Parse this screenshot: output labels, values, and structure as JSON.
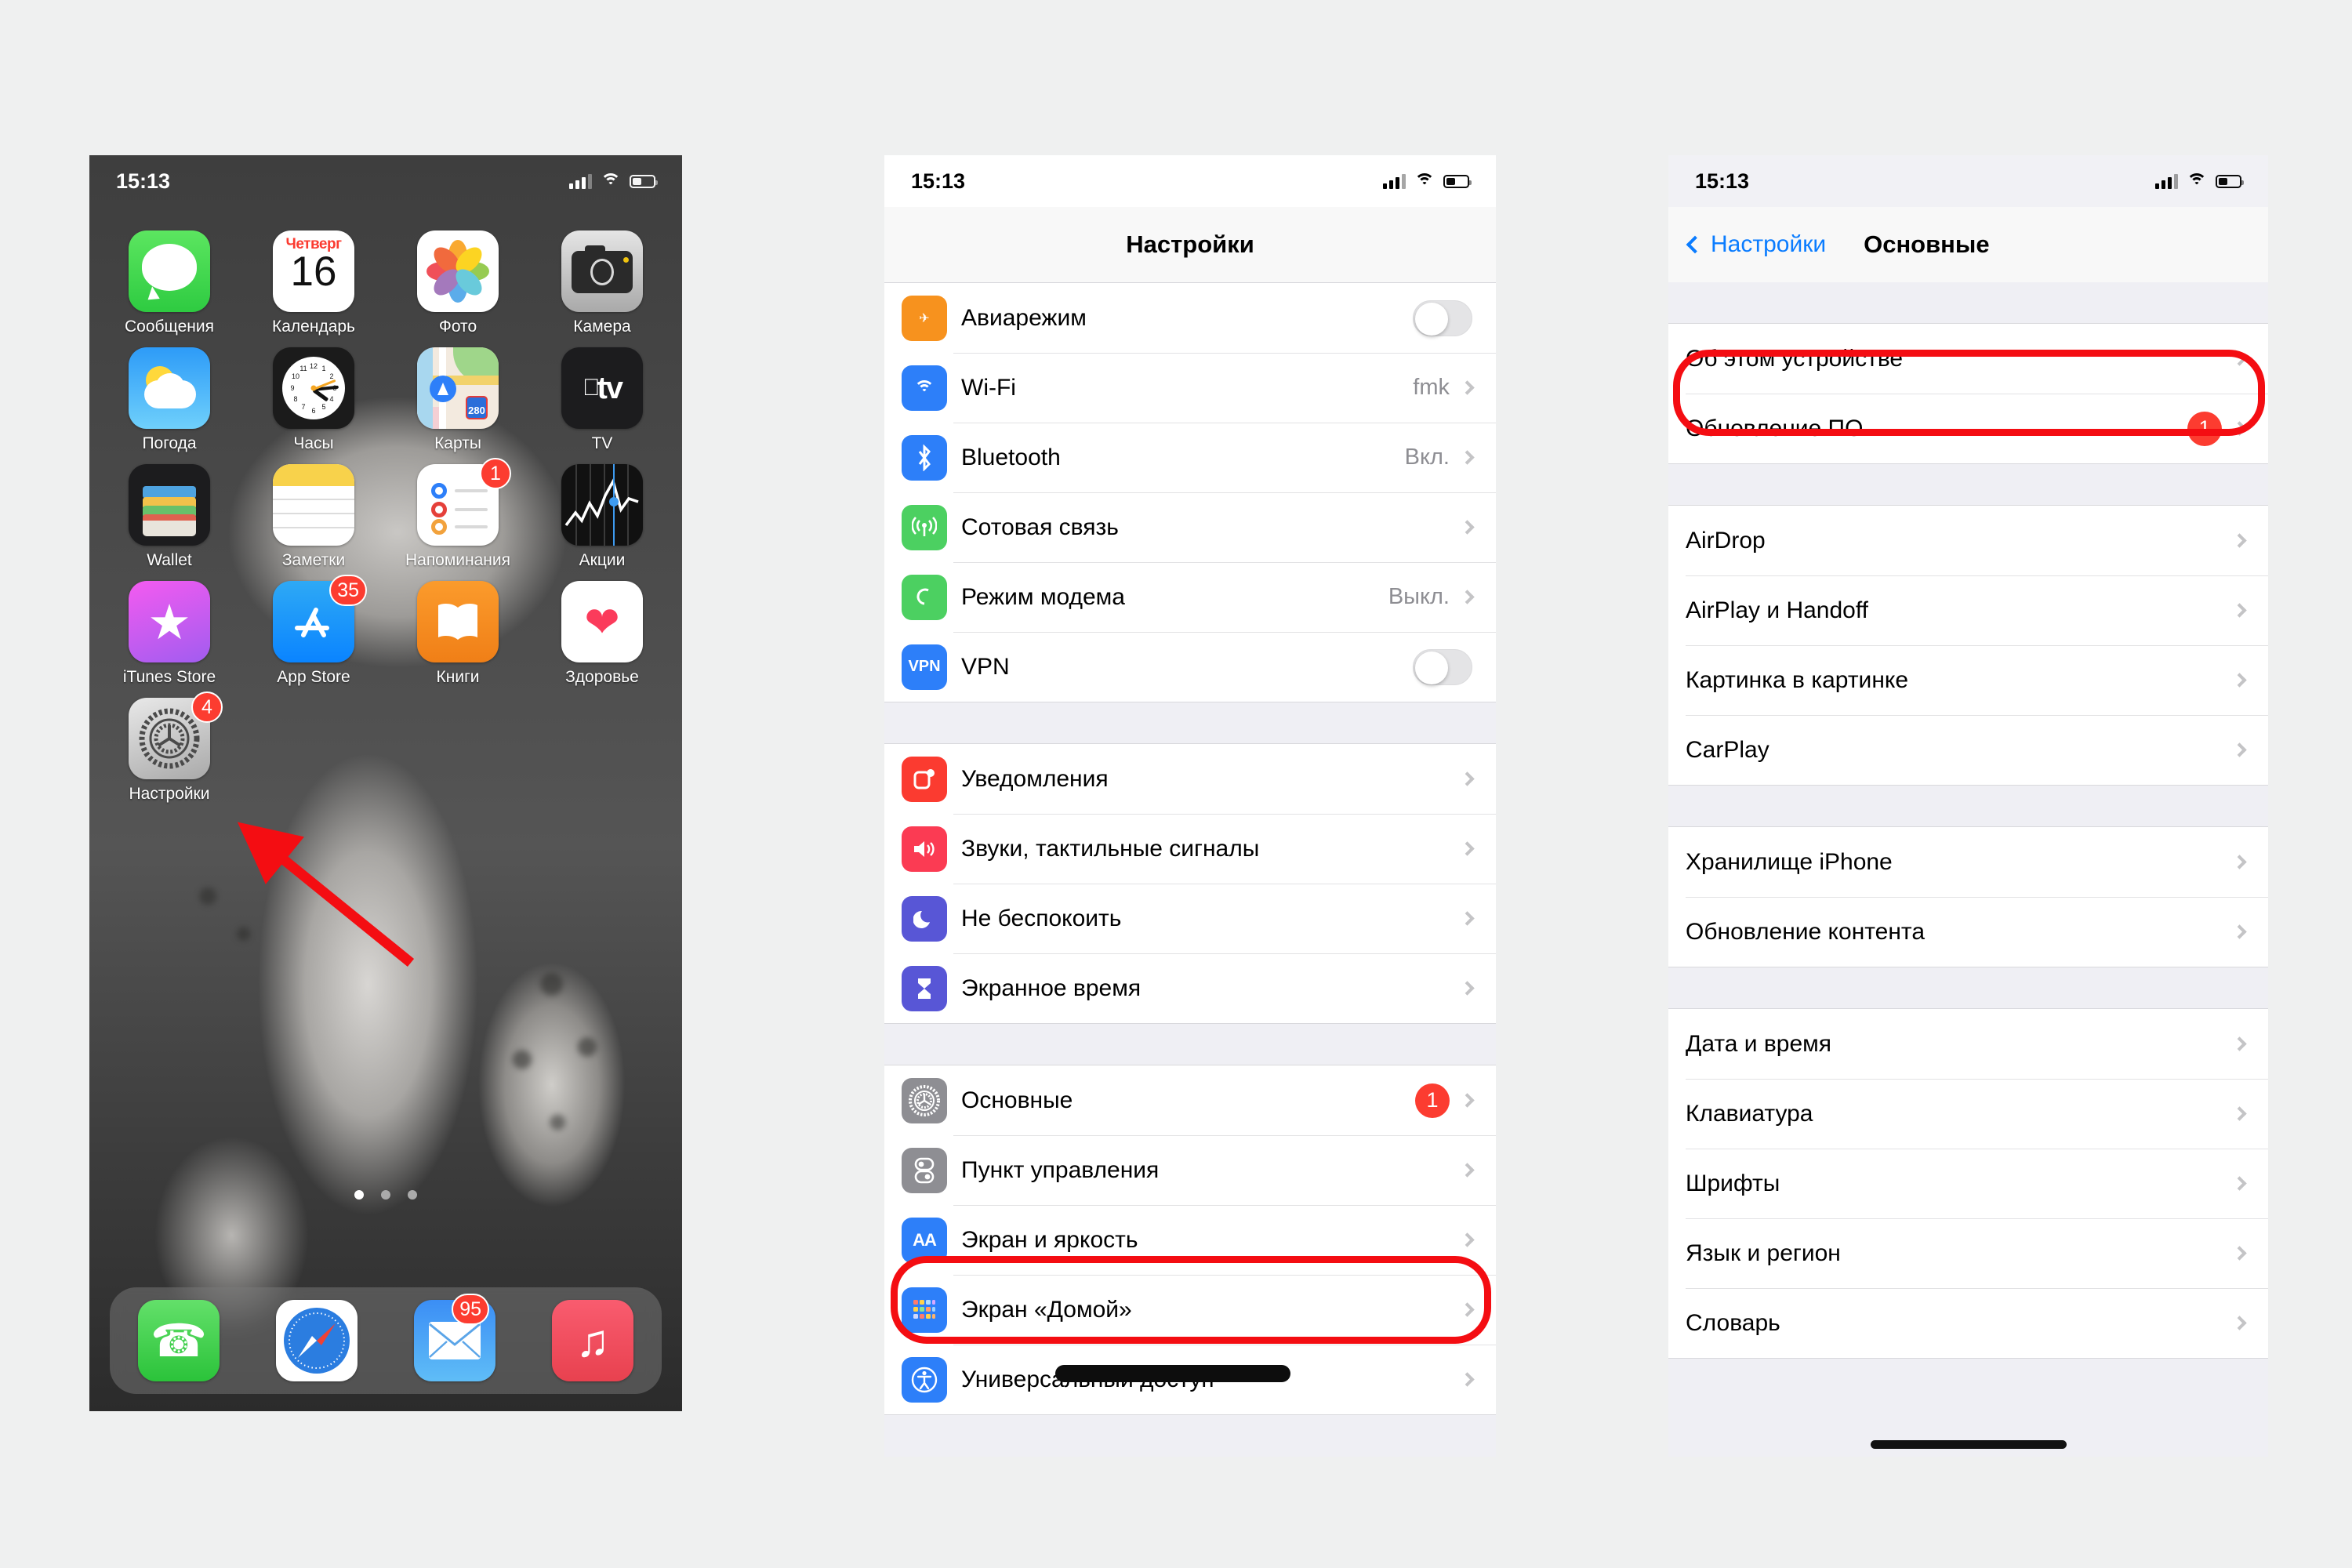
{
  "phone1": {
    "name": "iphone-home-screen",
    "status": {
      "time": "15:13",
      "signal_icon": "cellular-bars-icon",
      "wifi_icon": "wifi-icon",
      "battery_icon": "battery-icon"
    },
    "rows": [
      [
        {
          "label": "Сообщения",
          "icon": "messages-icon",
          "badge": null
        },
        {
          "label": "Календарь",
          "icon": "calendar-icon",
          "badge": null,
          "day": "Четверг",
          "date": "16"
        },
        {
          "label": "Фото",
          "icon": "photos-icon",
          "badge": null
        },
        {
          "label": "Камера",
          "icon": "camera-icon",
          "badge": null
        }
      ],
      [
        {
          "label": "Погода",
          "icon": "weather-icon",
          "badge": null
        },
        {
          "label": "Часы",
          "icon": "clock-icon",
          "badge": null
        },
        {
          "label": "Карты",
          "icon": "maps-icon",
          "badge": null,
          "route": "280"
        },
        {
          "label": "TV",
          "icon": "apple-tv-icon",
          "badge": null,
          "glyph": "tv"
        }
      ],
      [
        {
          "label": "Wallet",
          "icon": "wallet-icon",
          "badge": null
        },
        {
          "label": "Заметки",
          "icon": "notes-icon",
          "badge": null
        },
        {
          "label": "Напоминания",
          "icon": "reminders-icon",
          "badge": "1"
        },
        {
          "label": "Акции",
          "icon": "stocks-icon",
          "badge": null
        }
      ],
      [
        {
          "label": "iTunes Store",
          "icon": "itunes-store-icon",
          "badge": null
        },
        {
          "label": "App Store",
          "icon": "app-store-icon",
          "badge": "35"
        },
        {
          "label": "Книги",
          "icon": "books-icon",
          "badge": null
        },
        {
          "label": "Здоровье",
          "icon": "health-icon",
          "badge": null
        }
      ],
      [
        {
          "label": "Настройки",
          "icon": "settings-gear-icon",
          "badge": "4"
        }
      ]
    ],
    "dock": [
      {
        "label": "Телефон",
        "icon": "phone-icon",
        "badge": null
      },
      {
        "label": "Safari",
        "icon": "safari-compass-icon",
        "badge": null
      },
      {
        "label": "Почта",
        "icon": "mail-icon",
        "badge": "95"
      },
      {
        "label": "Музыка",
        "icon": "music-note-icon",
        "badge": null
      }
    ],
    "page_dots": {
      "total": 3,
      "active": 1
    },
    "annotation": {
      "arrow_color": "#f40d12",
      "points_to": "Настройки"
    }
  },
  "phone2": {
    "name": "settings-root",
    "status": {
      "time": "15:13"
    },
    "navbar": {
      "title": "Настройки"
    },
    "groups": [
      {
        "rows": [
          {
            "label": "Авиарежим",
            "icon": "airplane-icon",
            "icon_class": "c-air",
            "control": "toggle",
            "toggle_on": false
          },
          {
            "label": "Wi-Fi",
            "icon": "wifi-icon",
            "icon_class": "c-wifi",
            "value": "fmk",
            "control": "chevron"
          },
          {
            "label": "Bluetooth",
            "icon": "bluetooth-icon",
            "icon_class": "c-bt",
            "value": "Вкл.",
            "control": "chevron"
          },
          {
            "label": "Сотовая связь",
            "icon": "cellular-icon",
            "icon_class": "c-cell",
            "value": "",
            "control": "chevron"
          },
          {
            "label": "Режим модема",
            "icon": "hotspot-icon",
            "icon_class": "c-hot",
            "value": "Выкл.",
            "control": "chevron"
          },
          {
            "label": "VPN",
            "icon": "vpn-icon",
            "icon_class": "c-vpn",
            "glyph": "VPN",
            "control": "toggle",
            "toggle_on": false
          }
        ]
      },
      {
        "rows": [
          {
            "label": "Уведомления",
            "icon": "notifications-icon",
            "icon_class": "c-notif",
            "control": "chevron"
          },
          {
            "label": "Звуки, тактильные сигналы",
            "icon": "sounds-icon",
            "icon_class": "c-snd",
            "control": "chevron"
          },
          {
            "label": "Не беспокоить",
            "icon": "do-not-disturb-moon-icon",
            "icon_class": "c-dnd",
            "control": "chevron"
          },
          {
            "label": "Экранное время",
            "icon": "screen-time-hourglass-icon",
            "icon_class": "c-scr",
            "control": "chevron"
          }
        ]
      },
      {
        "rows": [
          {
            "label": "Основные",
            "icon": "settings-gear-icon",
            "icon_class": "c-gen",
            "badge": "1",
            "control": "chevron",
            "highlighted": true
          },
          {
            "label": "Пункт управления",
            "icon": "control-center-icon",
            "icon_class": "c-ctrl",
            "control": "chevron"
          },
          {
            "label": "Экран и яркость",
            "icon": "display-brightness-icon",
            "icon_class": "c-disp",
            "glyph": "AA",
            "control": "chevron"
          },
          {
            "label": "Экран «Домой»",
            "icon": "home-screen-icon",
            "icon_class": "c-home",
            "control": "chevron"
          },
          {
            "label": "Универсальный доступ",
            "icon": "accessibility-icon",
            "icon_class": "c-access",
            "control": "chevron",
            "redacted": true
          }
        ]
      }
    ]
  },
  "phone3": {
    "name": "settings-general",
    "status": {
      "time": "15:13"
    },
    "navbar": {
      "back_label": "Настройки",
      "title": "Основные",
      "back_icon": "chevron-left-icon"
    },
    "groups": [
      {
        "rows": [
          {
            "label": "Об этом устройстве",
            "control": "chevron",
            "highlighted": true
          },
          {
            "label": "Обновление ПО",
            "badge": "1",
            "control": "chevron"
          }
        ]
      },
      {
        "rows": [
          {
            "label": "AirDrop",
            "control": "chevron"
          },
          {
            "label": "AirPlay и Handoff",
            "control": "chevron"
          },
          {
            "label": "Картинка в картинке",
            "control": "chevron"
          },
          {
            "label": "CarPlay",
            "control": "chevron"
          }
        ]
      },
      {
        "rows": [
          {
            "label": "Хранилище iPhone",
            "control": "chevron"
          },
          {
            "label": "Обновление контента",
            "control": "chevron"
          }
        ]
      },
      {
        "rows": [
          {
            "label": "Дата и время",
            "control": "chevron"
          },
          {
            "label": "Клавиатура",
            "control": "chevron"
          },
          {
            "label": "Шрифты",
            "control": "chevron"
          },
          {
            "label": "Язык и регион",
            "control": "chevron"
          },
          {
            "label": "Словарь",
            "control": "chevron"
          }
        ]
      }
    ]
  },
  "colors": {
    "accent_red": "#f40d12",
    "ios_blue": "#0a7cff",
    "badge_red": "#fc3c30",
    "page_bg": "#eff0f0"
  }
}
